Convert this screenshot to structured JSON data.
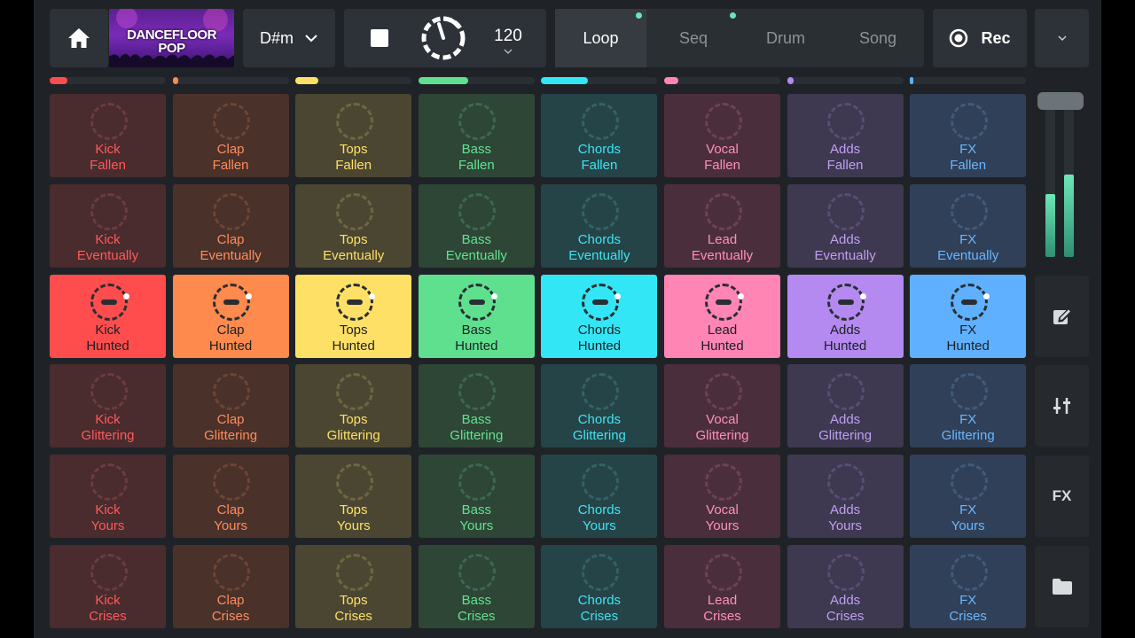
{
  "topbar": {
    "home_icon": "home-icon",
    "cover": {
      "line1": "DANCEFLOOR",
      "line2": "POP"
    },
    "key": {
      "value": "D#m",
      "chevron": "chevron-down-icon"
    },
    "stop_icon": "stop-icon",
    "tempo": {
      "dial": "tempo-dial-icon",
      "bpm": "120",
      "chevron": "chevron-down-icon"
    },
    "modes": [
      {
        "label": "Loop",
        "active": true,
        "dot": true
      },
      {
        "label": "Seq",
        "active": false,
        "dot": true
      },
      {
        "label": "Drum",
        "active": false,
        "dot": false
      },
      {
        "label": "Song",
        "active": false,
        "dot": false
      }
    ],
    "rec": {
      "icon": "record-icon",
      "label": "Rec"
    },
    "menu_icon": "chevron-down-icon"
  },
  "columns": [
    {
      "name": "Kick",
      "color": "#ff4d4d",
      "dim": "#4a2b2e",
      "text": "#ff5a5a",
      "ring": "#6b3c3e",
      "indicator": 0.15
    },
    {
      "name": "Clap",
      "color": "#ff8a4d",
      "dim": "#4a3129",
      "text": "#ff8c5c",
      "ring": "#6b4536",
      "indicator": 0.05
    },
    {
      "name": "Tops",
      "color": "#ffe066",
      "dim": "#4b4631",
      "text": "#ffe066",
      "ring": "#6e6642",
      "indicator": 0.2
    },
    {
      "name": "Bass",
      "color": "#5fe08f",
      "dim": "#2d4635",
      "text": "#63e292",
      "ring": "#3f6750",
      "indicator": 0.43
    },
    {
      "name": "Chords",
      "color": "#33e6f5",
      "dim": "#254448",
      "text": "#40e3f2",
      "ring": "#336266",
      "indicator": 0.4
    },
    {
      "name": "Vocal",
      "color": "#ff85b5",
      "dim": "#4b2e3b",
      "text": "#ff8fbd",
      "ring": "#6d4253",
      "indicator": 0.12
    },
    {
      "name": "Adds",
      "color": "#b48af0",
      "dim": "#3e3851",
      "text": "#bfa0f2",
      "ring": "#584e72",
      "indicator": 0.06
    },
    {
      "name": "FX",
      "color": "#5fb0ff",
      "dim": "#2f4058",
      "text": "#6ab6ff",
      "ring": "#425a7a",
      "indicator": 0.02
    }
  ],
  "rows": [
    {
      "label": "Fallen",
      "active": false,
      "names": [
        "Kick",
        "Clap",
        "Tops",
        "Bass",
        "Chords",
        "Vocal",
        "Adds",
        "FX"
      ]
    },
    {
      "label": "Eventually",
      "active": false,
      "names": [
        "Kick",
        "Clap",
        "Tops",
        "Bass",
        "Chords",
        "Lead",
        "Adds",
        "FX"
      ]
    },
    {
      "label": "Hunted",
      "active": true,
      "names": [
        "Kick",
        "Clap",
        "Tops",
        "Bass",
        "Chords",
        "Lead",
        "Adds",
        "FX"
      ]
    },
    {
      "label": "Glittering",
      "active": false,
      "names": [
        "Kick",
        "Clap",
        "Tops",
        "Bass",
        "Chords",
        "Vocal",
        "Adds",
        "FX"
      ]
    },
    {
      "label": "Yours",
      "active": false,
      "names": [
        "Kick",
        "Clap",
        "Tops",
        "Bass",
        "Chords",
        "Vocal",
        "Adds",
        "FX"
      ]
    },
    {
      "label": "Crises",
      "active": false,
      "names": [
        "Kick",
        "Clap",
        "Tops",
        "Bass",
        "Chords",
        "Lead",
        "Adds",
        "FX"
      ]
    }
  ],
  "side": {
    "volume": {
      "level_left": 0.42,
      "level_right": 0.55,
      "handle_icon": "volume-fader-icon"
    },
    "edit_icon": "edit-icon",
    "mixer_icon": "mixer-icon",
    "fx_label": "FX",
    "folder_icon": "folder-icon"
  }
}
